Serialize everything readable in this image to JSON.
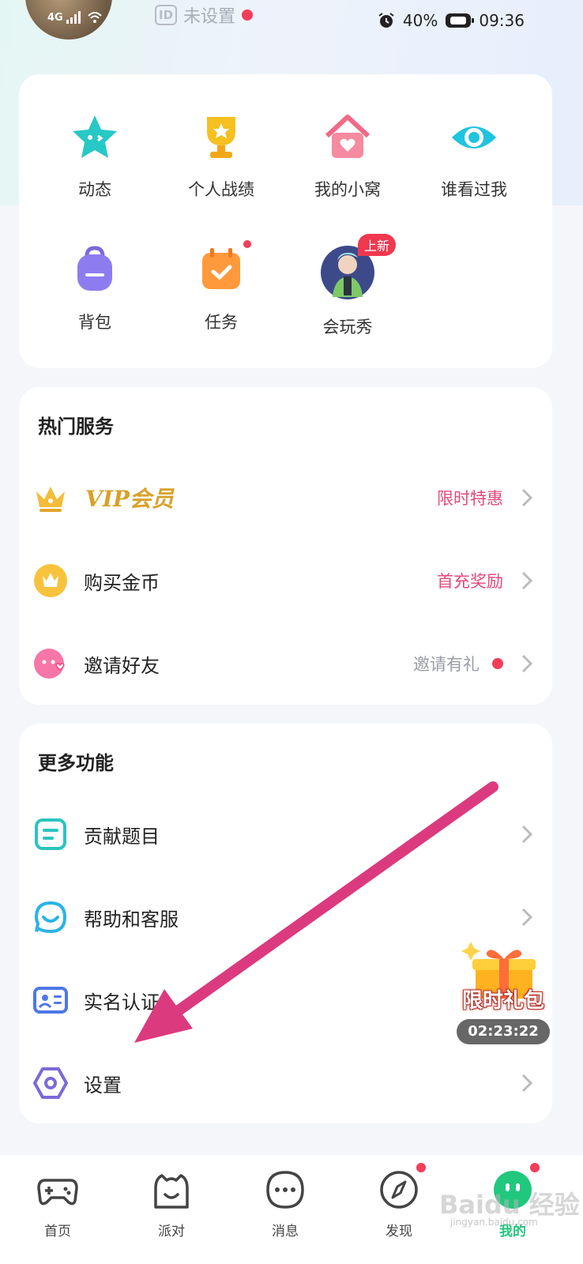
{
  "status": {
    "network": "4G",
    "battery": "40%",
    "time": "09:36"
  },
  "profile": {
    "id_label": "ID",
    "id_value": "未设置"
  },
  "grid": {
    "items": [
      {
        "label": "动态",
        "icon": "star-icon"
      },
      {
        "label": "个人战绩",
        "icon": "trophy-icon"
      },
      {
        "label": "我的小窝",
        "icon": "house-icon"
      },
      {
        "label": "谁看过我",
        "icon": "eye-icon"
      },
      {
        "label": "背包",
        "icon": "backpack-icon"
      },
      {
        "label": "任务",
        "icon": "calendar-check-icon"
      },
      {
        "label": "会玩秀",
        "icon": "avatar-figure-icon",
        "badge": "上新"
      }
    ]
  },
  "hot_services": {
    "title": "热门服务",
    "items": [
      {
        "label": "VIP会员",
        "tag": "限时特惠",
        "icon": "crown-icon"
      },
      {
        "label": "购买金币",
        "tag": "首充奖励",
        "icon": "coin-icon"
      },
      {
        "label": "邀请好友",
        "tag": "邀请有礼",
        "icon": "friend-face-icon"
      }
    ]
  },
  "more_features": {
    "title": "更多功能",
    "items": [
      {
        "label": "贡献题目",
        "icon": "document-icon"
      },
      {
        "label": "帮助和客服",
        "icon": "support-chat-icon"
      },
      {
        "label": "实名认证",
        "icon": "id-card-icon"
      },
      {
        "label": "设置",
        "icon": "settings-hexagon-icon"
      }
    ]
  },
  "gift_widget": {
    "label": "限时礼包",
    "timer": "02:23:22"
  },
  "tabs": [
    {
      "label": "首页",
      "icon": "gamepad-icon"
    },
    {
      "label": "派对",
      "icon": "party-icon"
    },
    {
      "label": "消息",
      "icon": "message-icon"
    },
    {
      "label": "发现",
      "icon": "compass-icon"
    },
    {
      "label": "我的",
      "icon": "me-face-icon"
    }
  ],
  "watermark": {
    "text": "Baidu 经验",
    "sub": "jingyan.baidu.com"
  },
  "colors": {
    "accent_pink": "#e6487a",
    "vip_gold": "#d9a12a",
    "teal": "#29c9c3",
    "purple": "#7b6ad8",
    "arrow": "#dc3a7e"
  }
}
